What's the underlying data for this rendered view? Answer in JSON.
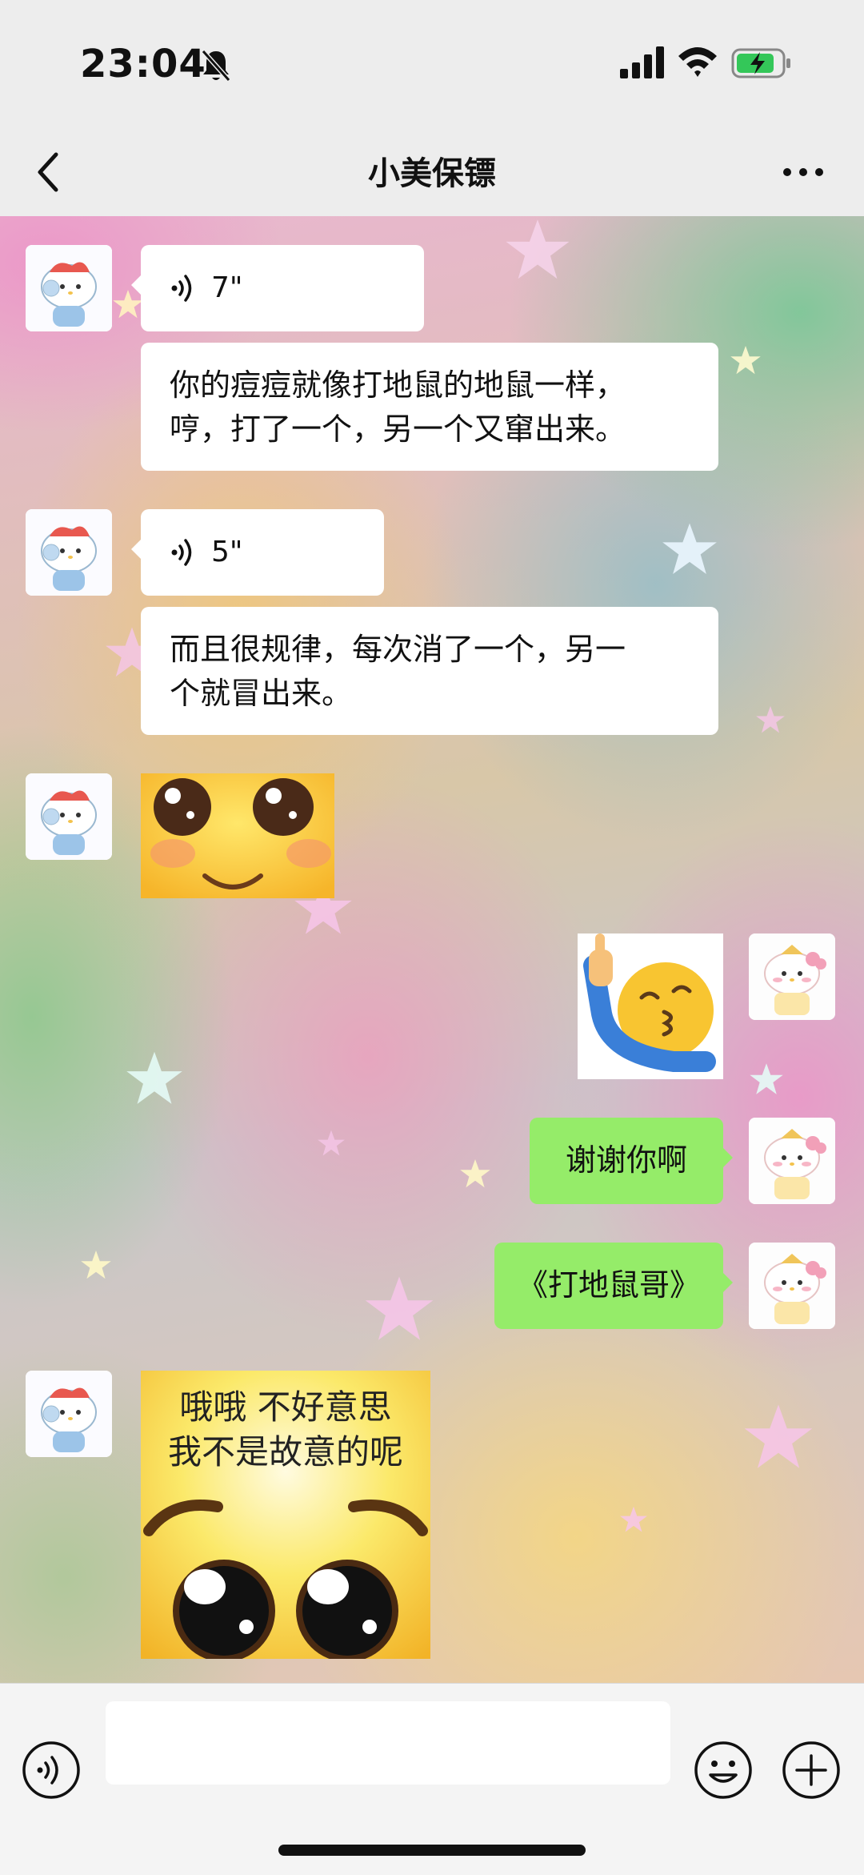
{
  "status_bar": {
    "time": "23:04"
  },
  "header": {
    "title": "小美保镖"
  },
  "messages": [
    {
      "side": "left",
      "type": "voice",
      "duration": "7\""
    },
    {
      "side": "left",
      "type": "text",
      "text": "你的痘痘就像打地鼠的地鼠一样，\n哼，打了一个，另一个又窜出来。"
    },
    {
      "side": "left",
      "type": "voice",
      "duration": "5\""
    },
    {
      "side": "left",
      "type": "text",
      "text": "而且很规律，每次消了一个，另一\n个就冒出来。"
    },
    {
      "side": "left",
      "type": "sticker",
      "name": "shy-smile-emoji"
    },
    {
      "side": "right",
      "type": "sticker",
      "name": "kissing-finger-up-emoji"
    },
    {
      "side": "right",
      "type": "text",
      "text": "谢谢你啊"
    },
    {
      "side": "right",
      "type": "text",
      "text": "《打地鼠哥》"
    },
    {
      "side": "left",
      "type": "sticker",
      "name": "pleading-face-emoji",
      "caption": "哦哦 不好意思\n我不是故意的呢"
    }
  ],
  "input_bar": {
    "placeholder": ""
  },
  "colors": {
    "sent_bubble": "#95ec69",
    "received_bubble": "#ffffff",
    "bar_bg": "#ededed"
  }
}
